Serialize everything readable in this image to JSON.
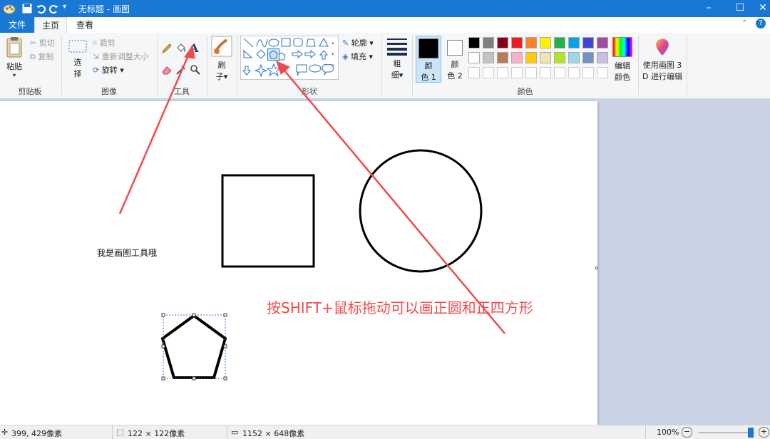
{
  "window": {
    "title": "无标题 - 画图"
  },
  "tabs": {
    "file": "文件",
    "home": "主页",
    "view": "查看"
  },
  "clipboard": {
    "paste": "粘贴",
    "cut": "剪切",
    "copy": "复制",
    "group": "剪贴板"
  },
  "image": {
    "select_1": "选",
    "select_2": "择",
    "crop": "裁剪",
    "resize": "重新调整大小",
    "rotate": "旋转",
    "group": "图像"
  },
  "tools": {
    "text_glyph": "A",
    "group": "工具"
  },
  "brushes": {
    "label_1": "刷",
    "label_2": "子"
  },
  "shapes": {
    "outline": "轮廓",
    "fill": "填充",
    "group": "形状"
  },
  "size": {
    "label_1": "粗",
    "label_2": "细"
  },
  "colors": {
    "color1_1": "颜",
    "color1_2": "色 1",
    "color2_1": "颜",
    "color2_2": "色 2",
    "edit_1": "编辑",
    "edit_2": "颜色",
    "group": "颜色",
    "palette_row1": [
      "#000000",
      "#7f7f7f",
      "#880015",
      "#ed1c24",
      "#ff7f27",
      "#fff200",
      "#22b14c",
      "#00a2e8",
      "#3f48cc",
      "#a349a4"
    ],
    "palette_row2": [
      "#ffffff",
      "#c3c3c3",
      "#b97a57",
      "#ffaec9",
      "#ffc90e",
      "#efe4b0",
      "#b5e61d",
      "#99d9ea",
      "#7092be",
      "#c8bfe7"
    ],
    "color1_value": "#000000",
    "color2_value": "#ffffff"
  },
  "paint3d": {
    "label_1": "使用画图 3",
    "label_2": "D 进行编辑"
  },
  "canvas": {
    "text": "我是画图工具哦",
    "annotation": "按SHIFT+鼠标拖动可以画正圆和正四方形",
    "annotation_color": "#ef4b4b"
  },
  "status": {
    "cursor": "399, 429像素",
    "selection": "122 × 122像素",
    "image_size": "1152 × 648像素",
    "zoom": "100%",
    "zoom_level": 1.0
  }
}
